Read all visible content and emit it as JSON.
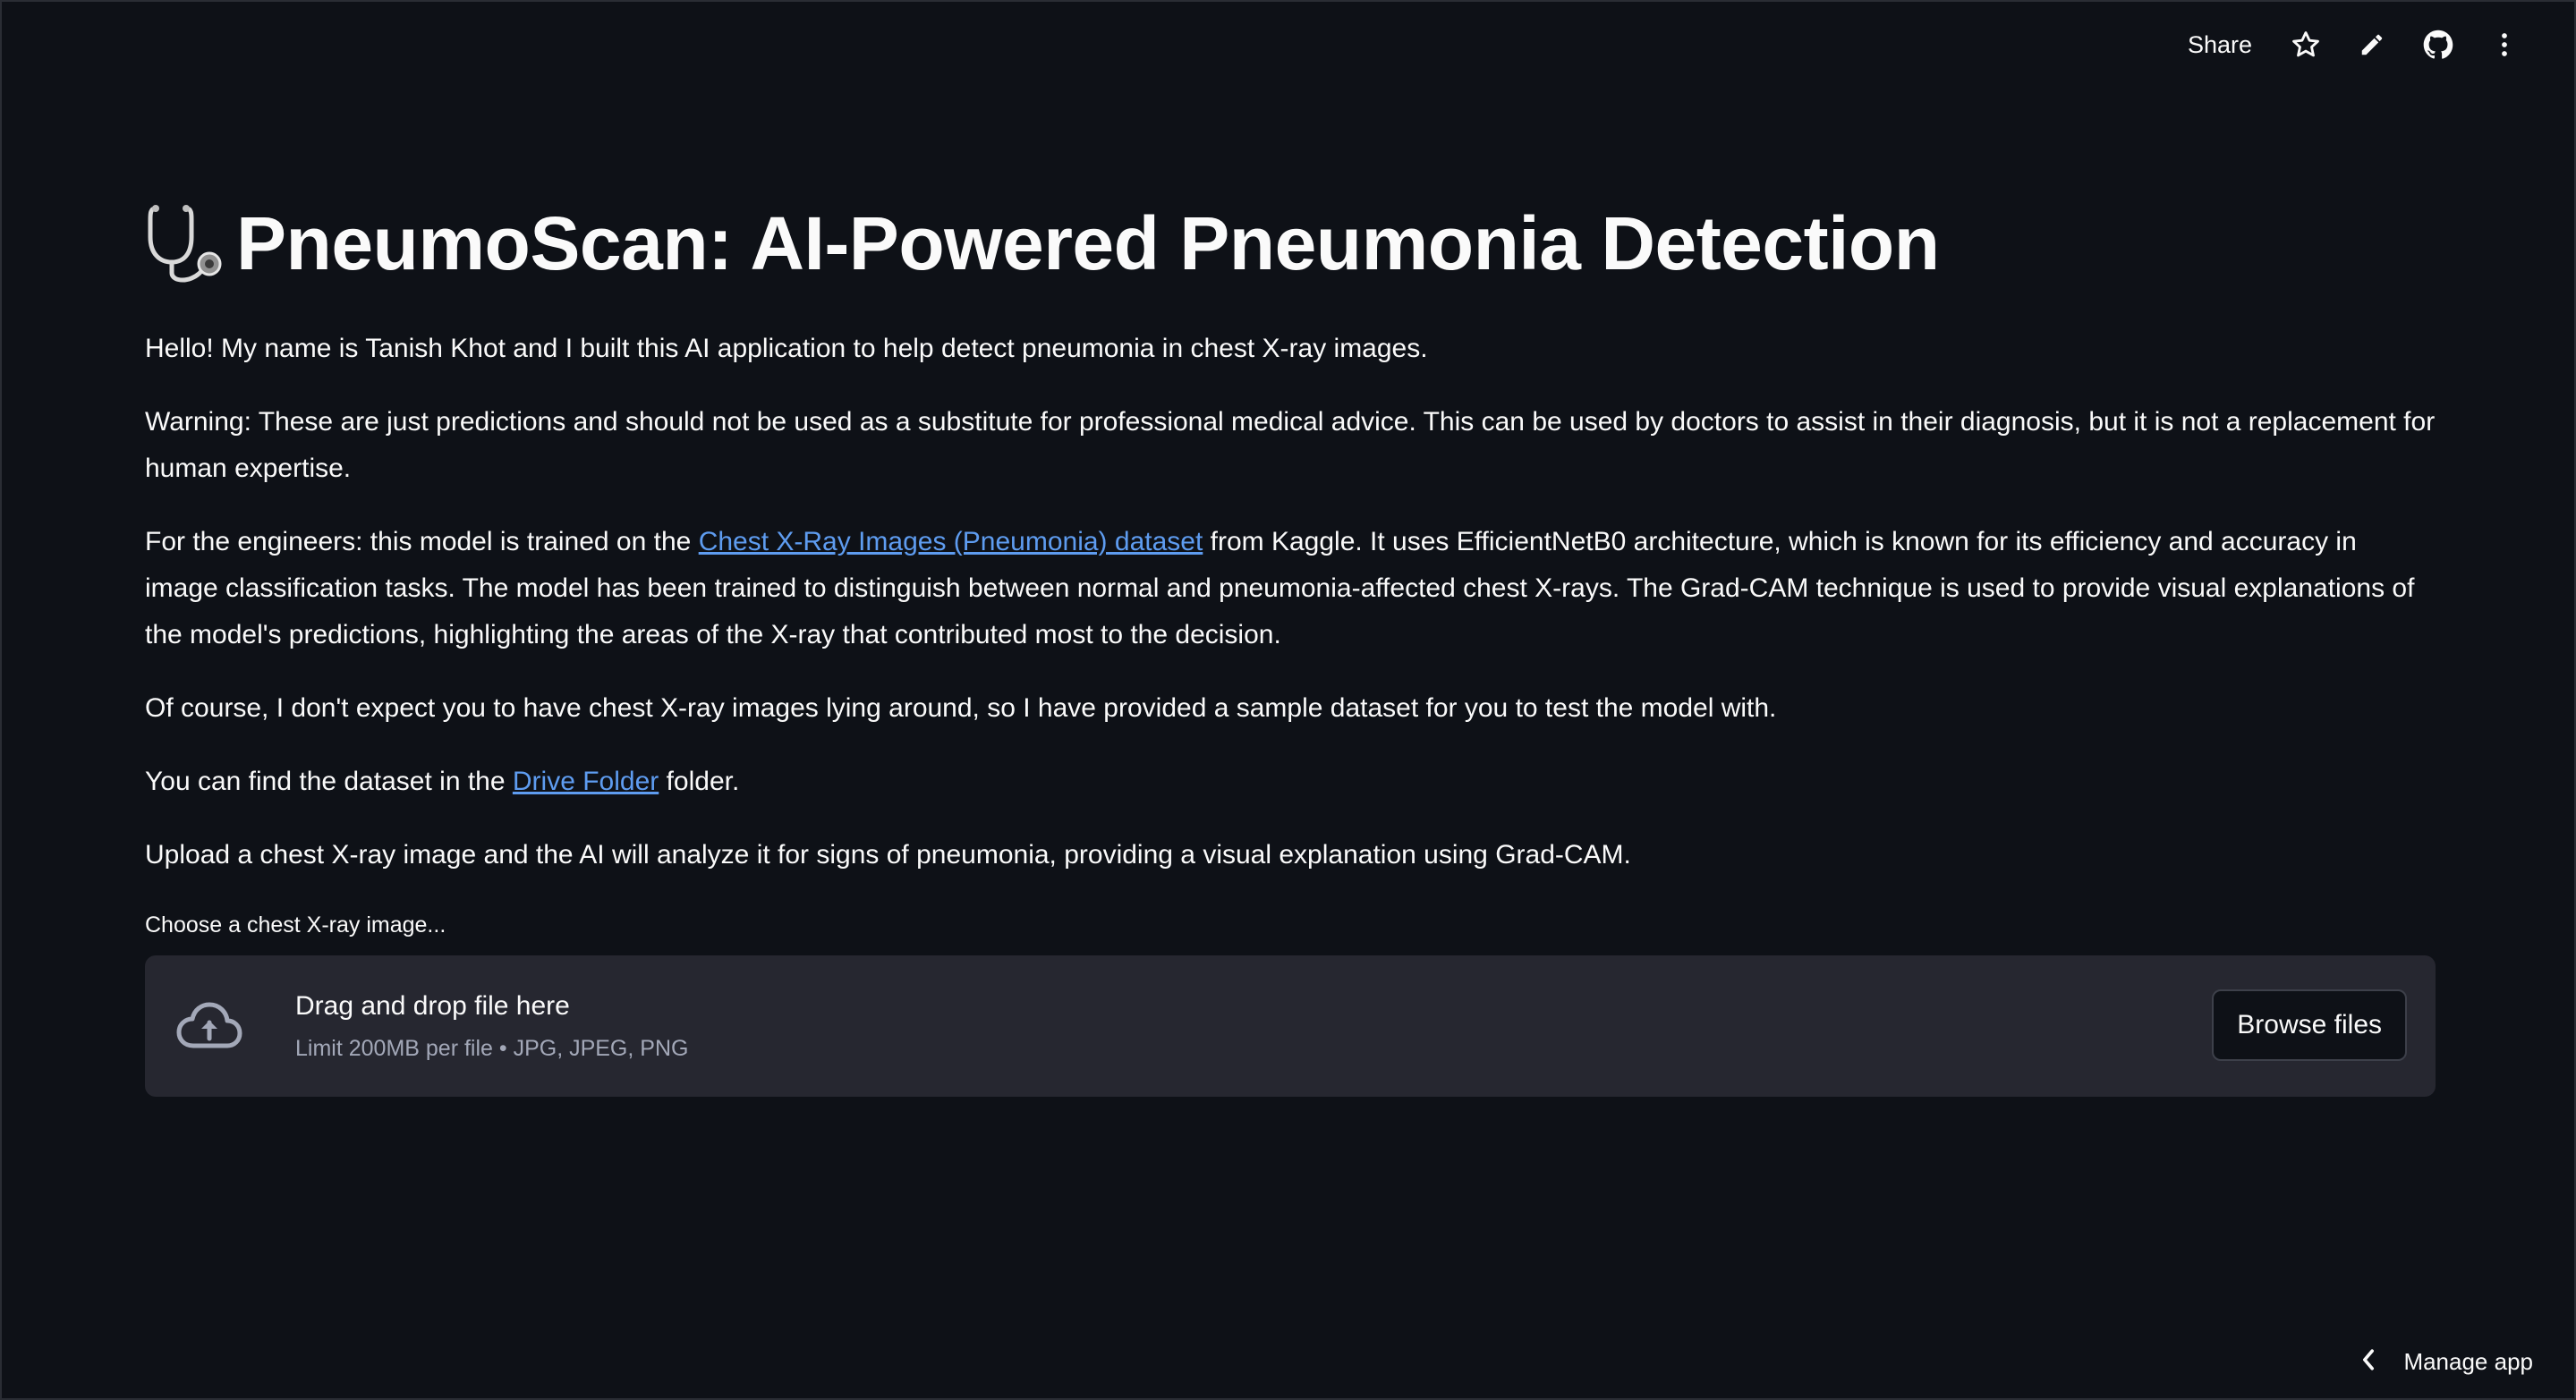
{
  "toolbar": {
    "share_label": "Share",
    "icons": [
      "star-icon",
      "pencil-icon",
      "github-icon",
      "kebab-menu-icon"
    ]
  },
  "header": {
    "emoji": "stethoscope-icon",
    "title": "PneumoScan: AI-Powered Pneumonia Detection"
  },
  "content": {
    "intro": "Hello! My name is Tanish Khot and I built this AI application to help detect pneumonia in chest X-ray images.",
    "warning": "Warning: These are just predictions and should not be used as a substitute for professional medical advice. This can be used by doctors to assist in their diagnosis, but it is not a replacement for human expertise.",
    "engineers_prefix": "For the engineers: this model is trained on the ",
    "engineers_link": "Chest X-Ray Images (Pneumonia) dataset",
    "engineers_suffix": " from Kaggle. It uses EfficientNetB0 architecture, which is known for its efficiency and accuracy in image classification tasks. The model has been trained to distinguish between normal and pneumonia-affected chest X-rays. The Grad-CAM technique is used to provide visual explanations of the model's predictions, highlighting the areas of the X-ray that contributed most to the decision.",
    "sample": "Of course, I don't expect you to have chest X-ray images lying around, so I have provided a sample dataset for you to test the model with.",
    "dataset_prefix": "You can find the dataset in the ",
    "dataset_link": "Drive Folder",
    "dataset_suffix": " folder.",
    "upload_instructions": "Upload a chest X-ray image and the AI will analyze it for signs of pneumonia, providing a visual explanation using Grad-CAM."
  },
  "uploader": {
    "label": "Choose a chest X-ray image...",
    "drop_text": "Drag and drop file here",
    "limit_text": "Limit 200MB per file • JPG, JPEG, PNG",
    "browse_label": "Browse files",
    "icon": "cloud-upload-icon"
  },
  "footer": {
    "manage_label": "Manage app",
    "icon": "chevron-left-icon"
  },
  "colors": {
    "background": "#0e1117",
    "panel": "#262730",
    "link": "#5e9cf0",
    "text": "#fafafa",
    "muted": "#a3a8b8"
  }
}
